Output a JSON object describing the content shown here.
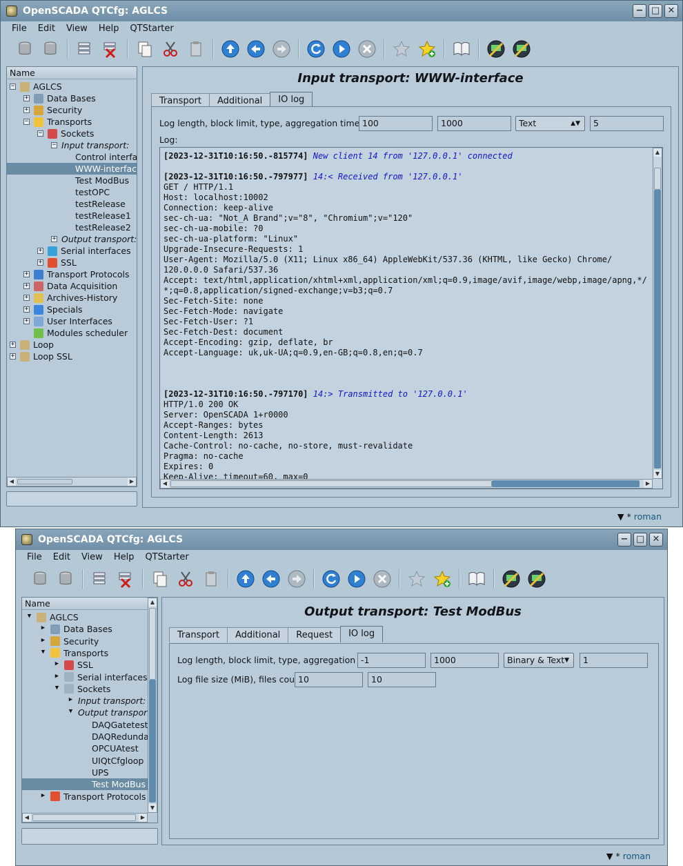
{
  "window1": {
    "title": "OpenSCADA QTCfg: AGLCS",
    "controls": {
      "min": "−",
      "max": "□",
      "close": "✕"
    },
    "menu": [
      "File",
      "Edit",
      "View",
      "Help",
      "QTStarter"
    ],
    "tree_header": "Name",
    "tree": [
      {
        "label": "AGLCS",
        "exp": "⊟"
      },
      {
        "label": "Data Bases",
        "exp": "⊞"
      },
      {
        "label": "Security",
        "exp": "⊞"
      },
      {
        "label": "Transports",
        "exp": "⊟"
      },
      {
        "label": "Sockets",
        "exp": "⊟"
      },
      {
        "label": "Input transport:",
        "exp": "⊟"
      },
      {
        "label": "Control interfa"
      },
      {
        "label": "WWW-interfac"
      },
      {
        "label": "Test ModBus"
      },
      {
        "label": "testOPC"
      },
      {
        "label": "testRelease"
      },
      {
        "label": "testRelease1"
      },
      {
        "label": "testRelease2"
      },
      {
        "label": "Output transport:",
        "exp": "⊞"
      },
      {
        "label": "Serial interfaces",
        "exp": "⊞"
      },
      {
        "label": "SSL",
        "exp": "⊞"
      },
      {
        "label": "Transport Protocols",
        "exp": "⊞"
      },
      {
        "label": "Data Acquisition",
        "exp": "⊞"
      },
      {
        "label": "Archives-History",
        "exp": "⊞"
      },
      {
        "label": "Specials",
        "exp": "⊞"
      },
      {
        "label": "User Interfaces",
        "exp": "⊞"
      },
      {
        "label": "Modules scheduler"
      },
      {
        "label": "Loop",
        "exp": "⊞"
      },
      {
        "label": "Loop SSL",
        "exp": "⊞"
      }
    ],
    "page_title": "Input transport: WWW-interface",
    "tabs": [
      "Transport",
      "Additional",
      "IO log"
    ],
    "active_tab": "IO log",
    "log_params_label": "Log length, block limit, type, aggregation time:",
    "log_length": "100",
    "block_limit": "1000",
    "log_type": "Text",
    "aggregation_time": "5",
    "log_label": "Log:",
    "log_lines": [
      {
        "ts": "[2023-12-31T10:16:50.-815774]",
        "msg": " New client 14 from '127.0.0.1' connected"
      },
      {
        "text": ""
      },
      {
        "ts": "[2023-12-31T10:16:50.-797977]",
        "msg": " 14:< Received from '127.0.0.1'"
      },
      {
        "text": "GET / HTTP/1.1"
      },
      {
        "text": "Host: localhost:10002"
      },
      {
        "text": "Connection: keep-alive"
      },
      {
        "text": "sec-ch-ua: \"Not_A Brand\";v=\"8\", \"Chromium\";v=\"120\""
      },
      {
        "text": "sec-ch-ua-mobile: ?0"
      },
      {
        "text": "sec-ch-ua-platform: \"Linux\""
      },
      {
        "text": "Upgrade-Insecure-Requests: 1"
      },
      {
        "text": "User-Agent: Mozilla/5.0 (X11; Linux x86_64) AppleWebKit/537.36 (KHTML, like Gecko) Chrome/"
      },
      {
        "text": "120.0.0.0 Safari/537.36"
      },
      {
        "text": "Accept: text/html,application/xhtml+xml,application/xml;q=0.9,image/avif,image/webp,image/apng,*/"
      },
      {
        "text": "*;q=0.8,application/signed-exchange;v=b3;q=0.7"
      },
      {
        "text": "Sec-Fetch-Site: none"
      },
      {
        "text": "Sec-Fetch-Mode: navigate"
      },
      {
        "text": "Sec-Fetch-User: ?1"
      },
      {
        "text": "Sec-Fetch-Dest: document"
      },
      {
        "text": "Accept-Encoding: gzip, deflate, br"
      },
      {
        "text": "Accept-Language: uk,uk-UA;q=0.9,en-GB;q=0.8,en;q=0.7"
      },
      {
        "text": ""
      },
      {
        "text": ""
      },
      {
        "text": ""
      },
      {
        "ts": "[2023-12-31T10:16:50.-797170]",
        "msg": " 14:> Transmitted to '127.0.0.1'"
      },
      {
        "text": "HTTP/1.0 200 OK"
      },
      {
        "text": "Server: OpenSCADA 1+r0000"
      },
      {
        "text": "Accept-Ranges: bytes"
      },
      {
        "text": "Content-Length: 2613"
      },
      {
        "text": "Cache-Control: no-cache, no-store, must-revalidate"
      },
      {
        "text": "Pragma: no-cache"
      },
      {
        "text": "Expires: 0"
      },
      {
        "text": "Keep-Alive: timeout=60, max=0"
      }
    ],
    "status_user": "roman",
    "status_mark": "▼ *"
  },
  "window2": {
    "title": "OpenSCADA QTCfg: AGLCS",
    "controls": {
      "min": "−",
      "max": "□",
      "close": "✕"
    },
    "menu": [
      "File",
      "Edit",
      "View",
      "Help",
      "QTStarter"
    ],
    "tree_header": "Name",
    "tree": [
      {
        "label": "AGLCS",
        "exp": "▾"
      },
      {
        "label": "Data Bases",
        "exp": "▸"
      },
      {
        "label": "Security",
        "exp": "▸"
      },
      {
        "label": "Transports",
        "exp": "▾"
      },
      {
        "label": "SSL",
        "exp": "▸"
      },
      {
        "label": "Serial interfaces",
        "exp": "▸"
      },
      {
        "label": "Sockets",
        "exp": "▾"
      },
      {
        "label": "Input transport:",
        "exp": "▸"
      },
      {
        "label": "Output transport:",
        "exp": "▾"
      },
      {
        "label": "DAQGatetestlo"
      },
      {
        "label": "DAQRedundan"
      },
      {
        "label": "OPCUAtest"
      },
      {
        "label": "UIQtCfgloop"
      },
      {
        "label": "UPS"
      },
      {
        "label": "Test ModBus"
      },
      {
        "label": "Transport Protocols",
        "exp": "▸"
      }
    ],
    "page_title": "Output transport: Test ModBus",
    "tabs": [
      "Transport",
      "Additional",
      "Request",
      "IO log"
    ],
    "active_tab": "IO log",
    "log_params_label": "Log length, block limit, type, aggregation time:",
    "log_length": "-1",
    "block_limit": "1000",
    "log_type": "Binary & Text",
    "aggregation_time": "1",
    "file_label": "Log file size (MiB), files count:",
    "file_size": "10",
    "files_count": "10",
    "status_user": "roman",
    "status_mark": "▼ *"
  },
  "colors": {
    "window_bg": "#b5c8d6",
    "selection": "#6a8ba4",
    "log_message": "#1414c8"
  },
  "toolbar_icons": [
    "db-load-icon",
    "db-save-icon",
    "add-item-icon",
    "delete-item-icon",
    "copy-icon",
    "cut-icon",
    "paste-icon",
    "up-icon",
    "back-icon",
    "forward-icon",
    "reload-icon",
    "start-icon",
    "stop-icon",
    "favorites-icon",
    "add-favorite-icon",
    "manual-icon",
    "remote-station-icon",
    "station-config-icon"
  ]
}
